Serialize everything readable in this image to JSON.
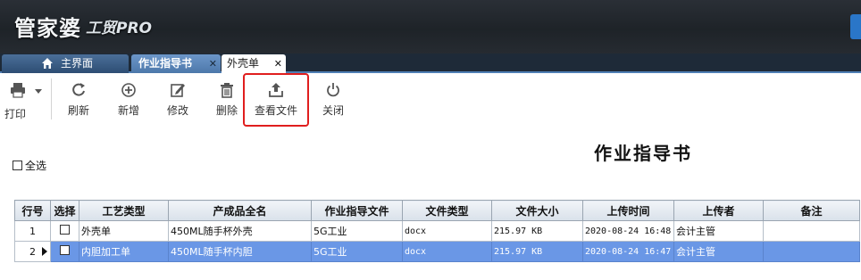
{
  "header": {
    "logo_text": "管家婆",
    "logo_sub": "工贸PRO"
  },
  "tabs": [
    {
      "label": "主界面"
    },
    {
      "label": "作业指导书",
      "close": "✕"
    },
    {
      "label": "外壳单",
      "close": "✕"
    }
  ],
  "toolbar": {
    "print": "打印",
    "refresh": "刷新",
    "add": "新增",
    "edit": "修改",
    "delete": "删除",
    "view_file": "查看文件",
    "close": "关闭"
  },
  "page": {
    "title": "作业指导书",
    "select_all": "全选"
  },
  "table": {
    "columns": [
      "行号",
      "选择",
      "工艺类型",
      "产成品全名",
      "作业指导文件",
      "文件类型",
      "文件大小",
      "上传时间",
      "上传者",
      "备注"
    ],
    "rows": [
      {
        "no": "1",
        "process": "外壳单",
        "product": "450ML随手杯外壳",
        "file": "5G工业",
        "type": "docx",
        "size": "215.97 KB",
        "time": "2020-08-24 16:48",
        "uploader": "会计主管",
        "note": ""
      },
      {
        "no": "2",
        "process": "内胆加工单",
        "product": "450ML随手杯内胆",
        "file": "5G工业",
        "type": "docx",
        "size": "215.97 KB",
        "time": "2020-08-24 16:47",
        "uploader": "会计主管",
        "note": ""
      }
    ]
  },
  "colors": {
    "header_bg": "#1e2328",
    "tab_active": "#5b86ba",
    "selected_row": "#6a97e6",
    "highlight_border": "#e01e1e"
  }
}
